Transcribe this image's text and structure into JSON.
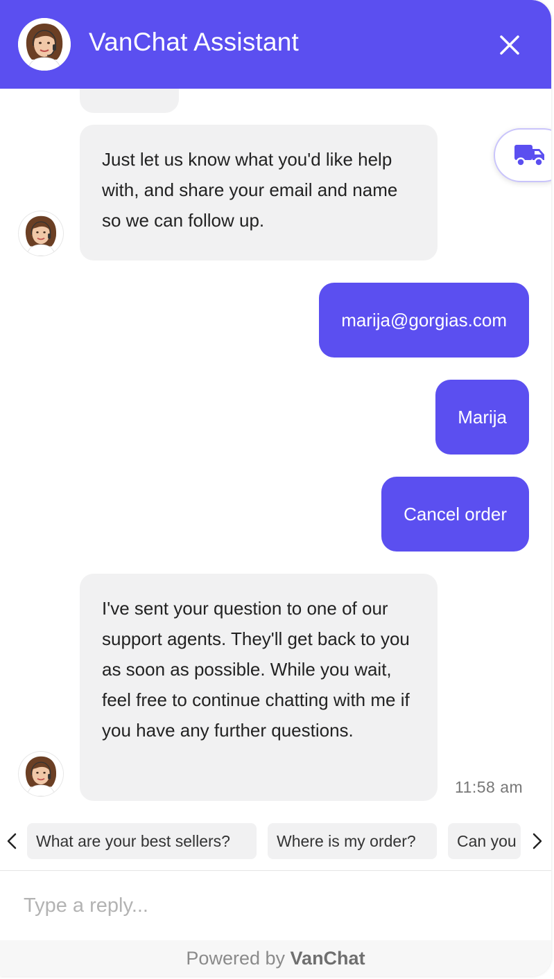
{
  "header": {
    "title": "VanChat Assistant",
    "avatar_icon": "agent-avatar"
  },
  "colors": {
    "brand": "#5b4ff0",
    "bot_bubble": "#f1f1f2"
  },
  "messages": [
    {
      "from": "bot",
      "text": "Just let us know what you'd like help with, and share your email and name so we can follow up."
    },
    {
      "from": "user",
      "text": "marija@gorgias.com"
    },
    {
      "from": "user",
      "text": "Marija"
    },
    {
      "from": "user",
      "text": "Cancel order"
    },
    {
      "from": "bot",
      "text": "I've sent your question to one of our support agents. They'll get back to you as soon as possible. While you wait, feel free to continue chatting with me if you have any further questions.",
      "time": "11:58 am"
    }
  ],
  "quick_replies": [
    "What are your best sellers?",
    "Where is my order?",
    "Can you"
  ],
  "reply": {
    "placeholder": "Type a reply..."
  },
  "footer": {
    "prefix": "Powered by",
    "brand": "VanChat"
  }
}
